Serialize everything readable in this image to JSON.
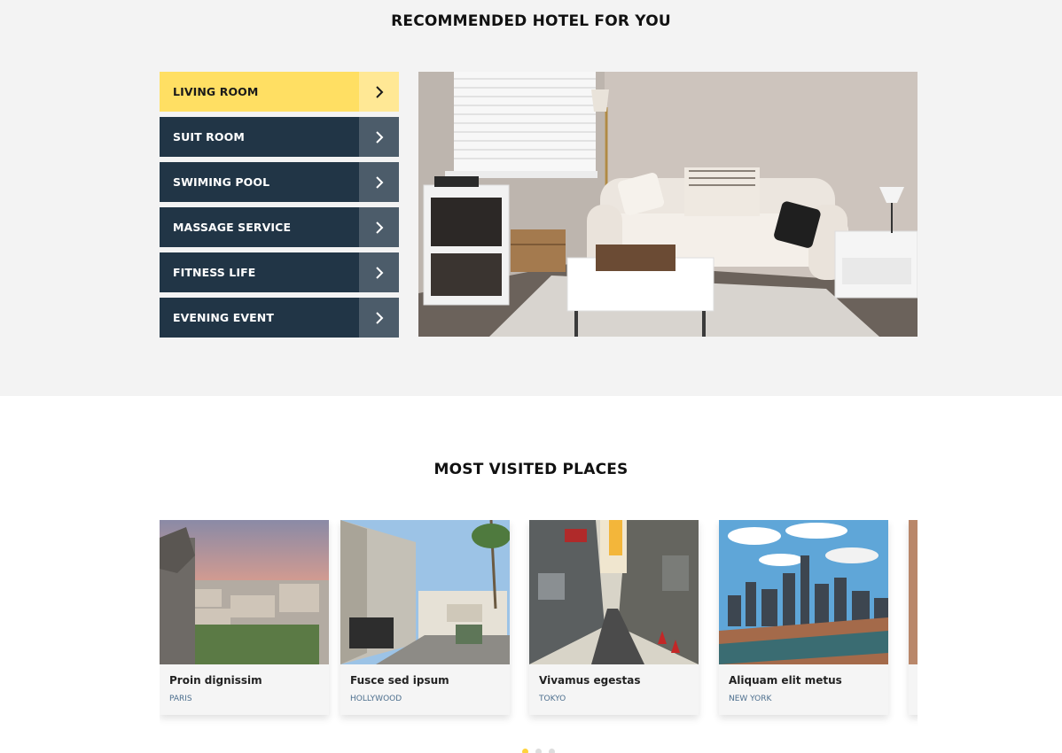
{
  "hotel_section": {
    "title": "RECOMMENDED HOTEL FOR YOU",
    "menu": [
      {
        "label": "LIVING ROOM",
        "active": true
      },
      {
        "label": "SUIT ROOM",
        "active": false
      },
      {
        "label": "SWIMING POOL",
        "active": false
      },
      {
        "label": "MASSAGE SERVICE",
        "active": false
      },
      {
        "label": "FITNESS LIFE",
        "active": false
      },
      {
        "label": "EVENING EVENT",
        "active": false
      }
    ],
    "accent_color": "#ffdf63",
    "dark_color": "#213546"
  },
  "places_section": {
    "title": "MOST VISITED PLACES",
    "cards": [
      {
        "name": "Proin dignissim",
        "city": "PARIS"
      },
      {
        "name": "Fusce sed ipsum",
        "city": "HOLLYWOOD"
      },
      {
        "name": "Vivamus egestas",
        "city": "TOKYO"
      },
      {
        "name": "Aliquam elit metus",
        "city": "NEW YORK"
      }
    ],
    "city_color": "#4d6f8e",
    "pagination_active": 1,
    "pagination_count": 3
  }
}
